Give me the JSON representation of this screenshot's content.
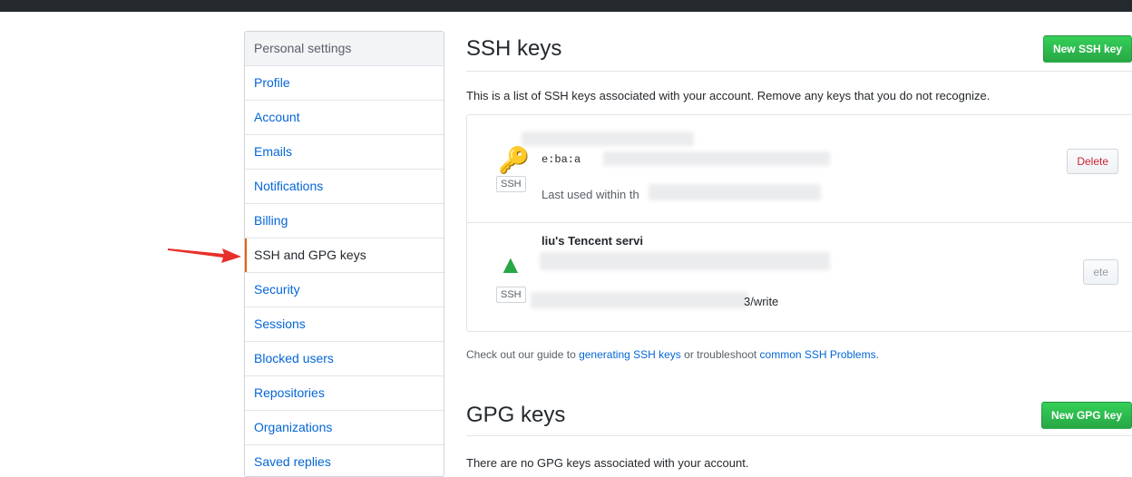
{
  "sidebar": {
    "header": "Personal settings",
    "items": [
      {
        "label": "Profile"
      },
      {
        "label": "Account"
      },
      {
        "label": "Emails"
      },
      {
        "label": "Notifications"
      },
      {
        "label": "Billing"
      },
      {
        "label": "SSH and GPG keys",
        "selected": true
      },
      {
        "label": "Security"
      },
      {
        "label": "Sessions"
      },
      {
        "label": "Blocked users"
      },
      {
        "label": "Repositories"
      },
      {
        "label": "Organizations"
      },
      {
        "label": "Saved replies"
      }
    ]
  },
  "ssh": {
    "title": "SSH keys",
    "new_button": "New SSH key",
    "description": "This is a list of SSH keys associated with your account. Remove any keys that you do not recognize.",
    "keys": [
      {
        "label": "SSH",
        "fingerprint_visible": "e:ba:a",
        "last_used_visible": "Last used within th",
        "delete_label": "Delete",
        "icon": "key-icon"
      },
      {
        "label": "SSH",
        "title_visible": "liu's Tencent servi",
        "last_used_visible": "3/write",
        "delete_label": "ete",
        "icon": "key-icon"
      }
    ],
    "guide": {
      "prefix": "Check out our guide to ",
      "link1": "generating SSH keys",
      "middle": " or troubleshoot ",
      "link2": "common SSH Problems",
      "suffix": "."
    }
  },
  "gpg": {
    "title": "GPG keys",
    "new_button": "New GPG key",
    "description": "There are no GPG keys associated with your account."
  },
  "colors": {
    "topbar": "#24292e",
    "link": "#0366d6",
    "selected_accent": "#e36209",
    "green_button": "#28a745",
    "delete_text": "#cb2431",
    "annotation_arrow": "#e8302a"
  }
}
